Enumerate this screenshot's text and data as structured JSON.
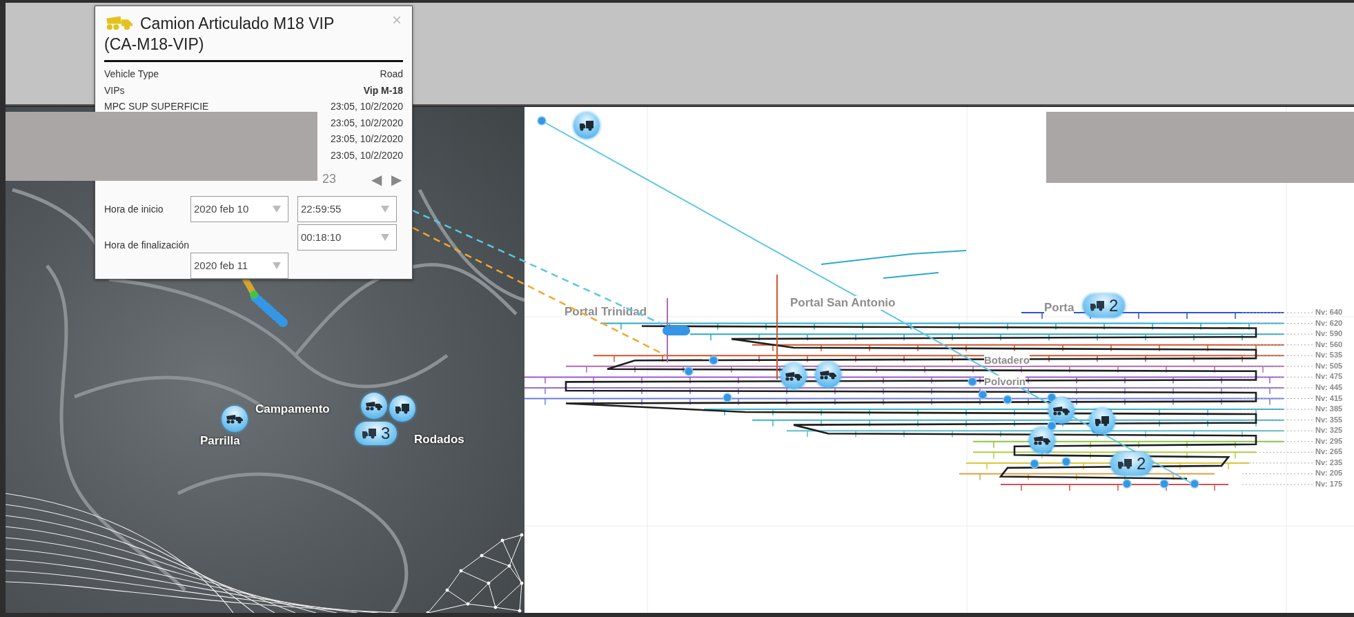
{
  "popup": {
    "title": "Camion Articulado M18 VIP (CA-M18-VIP)",
    "close": "×",
    "rows": [
      {
        "kind": "plain",
        "label": "Vehicle Type",
        "value": "Road"
      },
      {
        "kind": "strong",
        "label": "VIPs",
        "value": "Vip M-18"
      },
      {
        "kind": "plain",
        "label": "MPC SUP SUPERFICIE",
        "value": "23:05, 10/2/2020"
      },
      {
        "kind": "plain",
        "value": "23:05, 10/2/2020"
      },
      {
        "kind": "plain",
        "value": "23:05, 10/2/2020"
      },
      {
        "kind": "plain",
        "value": "23:05, 10/2/2020"
      }
    ],
    "pager": {
      "text": "23",
      "prev": "◀",
      "next": "▶"
    },
    "start": {
      "label": "Hora de inicio",
      "date": "2020 feb 10",
      "time": "22:59:55"
    },
    "end": {
      "label": "Hora de finalización",
      "time": "00:18:10",
      "date": "2020 feb 11"
    }
  },
  "map": {
    "places": [
      {
        "label": "Campamento"
      },
      {
        "label": "Parrilla"
      },
      {
        "label": "Rodados"
      }
    ],
    "markers": [
      {
        "kind": "dump-truck"
      },
      {
        "kind": "dump-truck"
      },
      {
        "kind": "truck"
      },
      {
        "kind": "cluster",
        "count": "3"
      }
    ]
  },
  "diagram": {
    "places": [
      {
        "label": "Portal Trinidad"
      },
      {
        "label": "Portal San Antonio"
      },
      {
        "label": "Porta"
      },
      {
        "label": "Botadero"
      },
      {
        "label": "Polvorin"
      }
    ],
    "markers": [
      {
        "kind": "truck"
      },
      {
        "kind": "dump-truck"
      },
      {
        "kind": "dump-truck"
      },
      {
        "kind": "dump-truck"
      },
      {
        "kind": "truck"
      },
      {
        "kind": "dump-truck"
      },
      {
        "kind": "cluster",
        "count": "2"
      },
      {
        "kind": "cluster",
        "count": "2"
      }
    ],
    "levels": [
      {
        "label": "Nv: 640"
      },
      {
        "label": "Nv: 620"
      },
      {
        "label": "Nv: 590"
      },
      {
        "label": "Nv: 560"
      },
      {
        "label": "Nv: 535"
      },
      {
        "label": "Nv: 505"
      },
      {
        "label": "Nv: 475"
      },
      {
        "label": "Nv: 445"
      },
      {
        "label": "Nv: 415"
      },
      {
        "label": "Nv: 385"
      },
      {
        "label": "Nv: 355"
      },
      {
        "label": "Nv: 325"
      },
      {
        "label": "Nv: 295"
      },
      {
        "label": "Nv: 265"
      },
      {
        "label": "Nv: 235"
      },
      {
        "label": "Nv: 205"
      },
      {
        "label": "Nv: 175"
      }
    ]
  }
}
